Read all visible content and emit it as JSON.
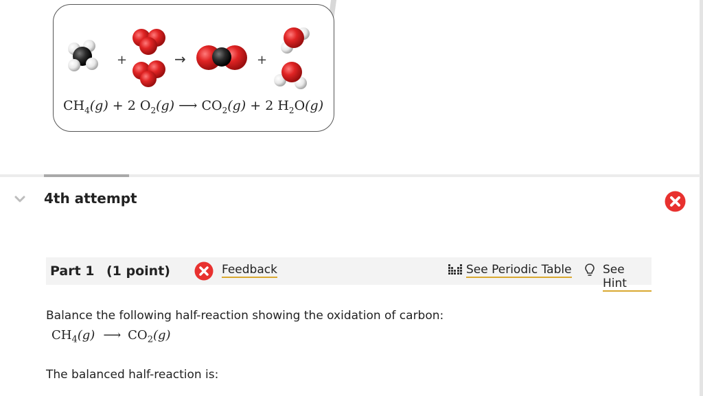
{
  "reaction": {
    "equation_parts": {
      "ch4": "CH",
      "ch4_sub": "4",
      "g1": "(g)",
      "plus1": " + 2 ",
      "o2": "O",
      "o2_sub": "2",
      "g2": "(g)",
      "arrow": " ⟶ ",
      "co2": "CO",
      "co2_sub": "2",
      "g3": "(g)",
      "plus2": " + 2 ",
      "h2o": "H",
      "h2o_sub": "2",
      "h2o_o": "O",
      "g4": "(g)"
    },
    "molecule_plus": "+",
    "molecule_arrow": "→"
  },
  "attempt": {
    "title": "4th attempt"
  },
  "part": {
    "label": "Part 1",
    "points": "(1 point)",
    "feedback_label": "Feedback",
    "periodic_table_label": "See Periodic Table",
    "hint_label": "See Hint"
  },
  "question": {
    "prompt": "Balance the following half-reaction showing the oxidation of carbon:",
    "reactant": "CH",
    "reactant_sub": "4",
    "reactant_state": "(g)",
    "arrow": "⟶",
    "product": "CO",
    "product_sub": "2",
    "product_state": "(g)",
    "answer_label": "The balanced half-reaction is:"
  },
  "colors": {
    "error_red": "#e8312f",
    "link_underline": "#d9a830",
    "oxygen": "#dd2222",
    "carbon": "#2a2a2a",
    "hydrogen": "#f2f2f2"
  },
  "icons": [
    "chevron-down-icon",
    "close-icon",
    "error-icon",
    "periodic-table-icon",
    "lightbulb-icon"
  ]
}
